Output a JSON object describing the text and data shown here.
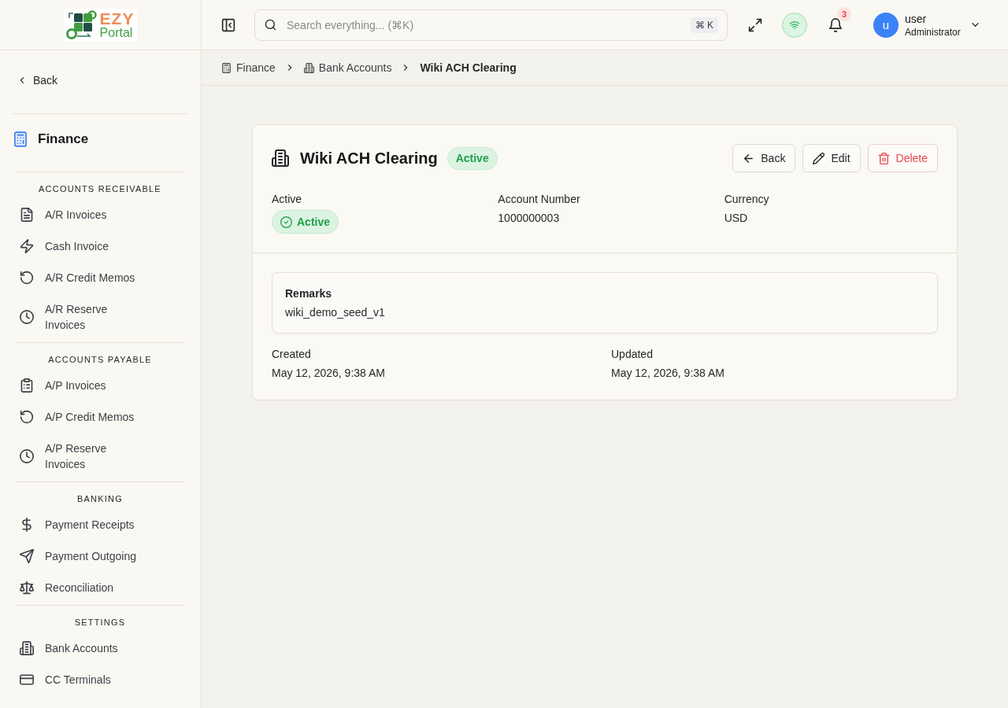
{
  "sidebar": {
    "logo": {
      "line_1": "EZY",
      "line_2": "Portal"
    },
    "back": "Back",
    "module": "Finance",
    "sections": [
      {
        "heading": "ACCOUNTS RECEIVABLE",
        "items": [
          {
            "label": "A/R Invoices",
            "selected": false
          },
          {
            "label": "Cash Invoice",
            "selected": false
          },
          {
            "label": "A/R Credit Memos",
            "selected": false
          },
          {
            "label": "A/R Reserve Invoices",
            "selected": false
          }
        ]
      },
      {
        "heading": "ACCOUNTS PAYABLE",
        "items": [
          {
            "label": "A/P Invoices",
            "selected": false
          },
          {
            "label": "A/P Credit Memos",
            "selected": false
          },
          {
            "label": "A/P Reserve Invoices",
            "selected": false
          }
        ]
      },
      {
        "heading": "BANKING",
        "items": [
          {
            "label": "Payment Receipts",
            "selected": false
          },
          {
            "label": "Payment Outgoing",
            "selected": false
          },
          {
            "label": "Reconciliation",
            "selected": false
          }
        ]
      },
      {
        "heading": "SETTINGS",
        "items": [
          {
            "label": "Bank Accounts",
            "selected": false
          },
          {
            "label": "CC Terminals",
            "selected": false
          }
        ]
      }
    ]
  },
  "topbar": {
    "search": {
      "placeholder": "Search everything... (⌘K)",
      "shortcut": "⌘ K"
    },
    "notification_count": "3",
    "user": {
      "avatar": "u",
      "name": "user",
      "role": "Administrator"
    }
  },
  "breadcrumb": [
    {
      "label": "Finance",
      "kind": "link"
    },
    {
      "label": "Bank Accounts",
      "kind": "link"
    },
    {
      "label": "Wiki ACH Clearing",
      "kind": "current"
    }
  ],
  "record": {
    "title": "Wiki ACH Clearing",
    "status": "Active",
    "actions": [
      {
        "label": "Back",
        "kind": "back"
      },
      {
        "label": "Edit",
        "kind": "edit"
      },
      {
        "label": "Delete",
        "kind": "delete"
      }
    ],
    "fields": [
      {
        "label": "Active",
        "value": "Active",
        "kind": "badge"
      },
      {
        "label": "Account Number",
        "value": "1000000003",
        "kind": "text"
      },
      {
        "label": "Currency",
        "value": "USD",
        "kind": "text"
      }
    ],
    "remarks": {
      "label": "Remarks",
      "value": "wiki_demo_seed_v1"
    },
    "timestamps": [
      {
        "label": "Created",
        "value": "May 12, 2026, 9:38 AM"
      },
      {
        "label": "Updated",
        "value": "May 12, 2026, 9:38 AM"
      }
    ]
  }
}
